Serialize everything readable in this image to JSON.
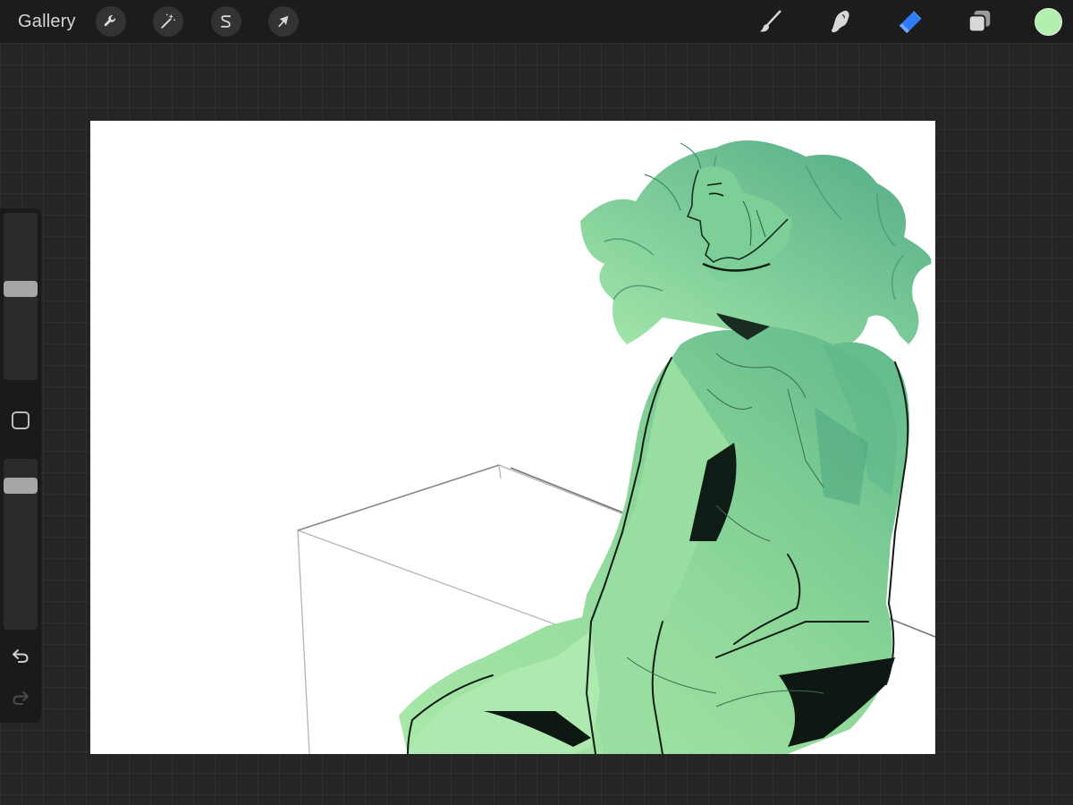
{
  "toolbar": {
    "gallery_label": "Gallery",
    "left_tools": [
      {
        "name": "actions",
        "icon": "wrench-icon"
      },
      {
        "name": "adjustments",
        "icon": "magic-wand-icon"
      },
      {
        "name": "selection",
        "icon": "selection-s-icon"
      },
      {
        "name": "transform",
        "icon": "arrow-cursor-icon"
      }
    ],
    "right_tools": [
      {
        "name": "brush",
        "icon": "brush-icon",
        "active": false
      },
      {
        "name": "smudge",
        "icon": "smudge-finger-icon",
        "active": false
      },
      {
        "name": "eraser",
        "icon": "eraser-icon",
        "active": true
      },
      {
        "name": "layers",
        "icon": "layers-icon",
        "active": false
      }
    ],
    "current_color": "#b3f0b0",
    "active_tool_color": "#2f7cf6"
  },
  "sidebar": {
    "brush_size_level": 0.55,
    "opacity_level": 0.1,
    "modify_icon": "square-icon",
    "undo_icon": "undo-arrow-icon",
    "redo_icon": "redo-arrow-icon",
    "redo_enabled": false
  },
  "canvas": {
    "background": "#ffffff",
    "artwork": "green-figure-sketch"
  }
}
